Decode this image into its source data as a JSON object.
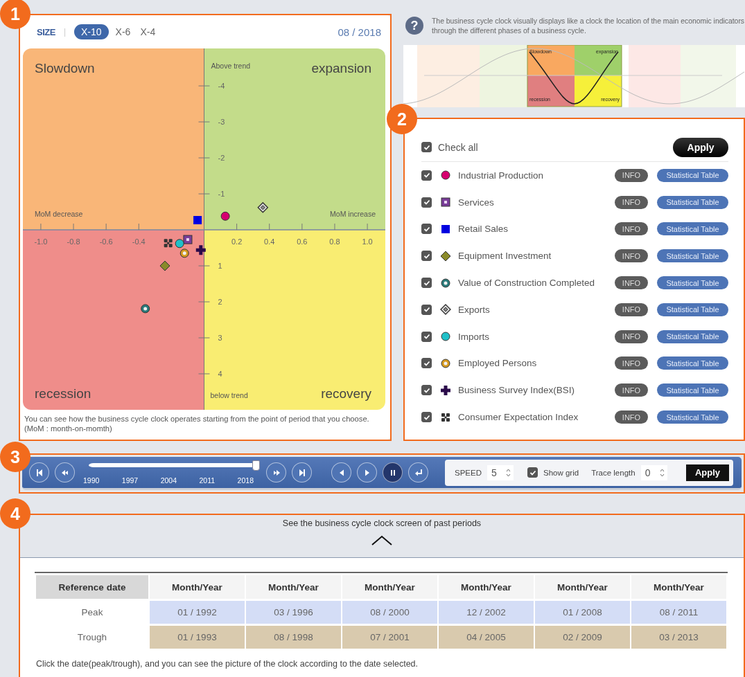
{
  "badges": [
    {
      "label": "1"
    },
    {
      "label": "2"
    },
    {
      "label": "3"
    },
    {
      "label": "4"
    }
  ],
  "clock_panel": {
    "quadrants": [
      {
        "label": "Slowdown",
        "color": "#f9b678"
      },
      {
        "label": "expansion",
        "color": "#c3dc8a"
      },
      {
        "label": "recession",
        "color": "#ef8d8a"
      },
      {
        "label": "recovery",
        "color": "#f9ed72"
      }
    ],
    "axis_labels": [
      {
        "kind": "top",
        "label": "Above trend"
      },
      {
        "kind": "bottom",
        "label": "below trend"
      },
      {
        "kind": "left",
        "label": "MoM decrease"
      },
      {
        "kind": "right",
        "label": "MoM increase"
      }
    ],
    "size_label": "SIZE",
    "separator": "|",
    "size_tabs": [
      {
        "label": "X-10",
        "selected": true
      },
      {
        "label": "X-6",
        "selected": false
      },
      {
        "label": "X-4",
        "selected": false
      }
    ],
    "date": "08 / 2018",
    "chart_data": {
      "type": "scatter",
      "xlim": [
        -1.11,
        1.11
      ],
      "ylim": [
        5.0,
        -5.04
      ],
      "xticks": [
        {
          "value": -1,
          "label": "-1.0"
        },
        {
          "value": -0.8,
          "label": "-0.8"
        },
        {
          "value": -0.6,
          "label": "-0.6"
        },
        {
          "value": -0.4,
          "label": "-0.4"
        },
        {
          "value": 0.2,
          "label": "0.2"
        },
        {
          "value": 0.4,
          "label": "0.4"
        },
        {
          "value": 0.6,
          "label": "0.6"
        },
        {
          "value": 0.8,
          "label": "0.8"
        },
        {
          "value": 1,
          "label": "1.0"
        }
      ],
      "yticks": [
        {
          "value": -4,
          "label": "-4"
        },
        {
          "value": -3,
          "label": "-3"
        },
        {
          "value": -2,
          "label": "-2"
        },
        {
          "value": -1,
          "label": "-1"
        },
        {
          "value": 1,
          "label": "1"
        },
        {
          "value": 2,
          "label": "2"
        },
        {
          "value": 3,
          "label": "3"
        },
        {
          "value": 4,
          "label": "4"
        }
      ],
      "series": [
        {
          "color": "#d6006f",
          "x": [
            0.13
          ],
          "values": [
            -0.38
          ]
        },
        {
          "color": "#7a3d9a",
          "x": [
            -0.1
          ],
          "values": [
            0.27
          ]
        },
        {
          "color": "#0000e0",
          "x": [
            -0.04
          ],
          "values": [
            -0.27
          ]
        },
        {
          "color": "#8a8a2a",
          "x": [
            -0.24
          ],
          "values": [
            1.0
          ]
        },
        {
          "color": "#2a7a7a",
          "x": [
            -0.36
          ],
          "values": [
            2.19
          ]
        },
        {
          "color": "#888888",
          "x": [
            0.36
          ],
          "values": [
            -0.62
          ]
        },
        {
          "color": "#20c0c8",
          "x": [
            -0.15
          ],
          "values": [
            0.38
          ]
        },
        {
          "color": "#d69a20",
          "x": [
            -0.12
          ],
          "values": [
            0.65
          ]
        },
        {
          "color": "#2a0a4a",
          "x": [
            -0.02
          ],
          "values": [
            0.56
          ]
        },
        {
          "color": "#333333",
          "x": [
            -0.22
          ],
          "values": [
            0.37
          ]
        }
      ]
    },
    "caption": "You can see how the business cycle clock operates starting from the point of period that you choose. (MoM : month-on-momth)"
  },
  "help": {
    "icon_glyph": "?",
    "text": "The business cycle clock visually displays like a clock the location of the main economic indicators through the different phases of a business cycle.",
    "diagram_labels": [
      "Slowdown",
      "expansion",
      "recession",
      "recovery"
    ]
  },
  "indicator_panel": {
    "check_all": {
      "label": "Check all",
      "checked": true
    },
    "apply": "Apply",
    "indicators": [
      {
        "name": "Industrial Production",
        "kind": "circle",
        "color": "#d6006f",
        "checked": true,
        "info": "INFO",
        "table": "Statistical Table"
      },
      {
        "name": "Services",
        "kind": "square-dot",
        "color": "#7a3d9a",
        "checked": true,
        "info": "INFO",
        "table": "Statistical Table"
      },
      {
        "name": "Retail Sales",
        "kind": "square",
        "color": "#0000e0",
        "checked": true,
        "info": "INFO",
        "table": "Statistical Table"
      },
      {
        "name": "Equipment Investment",
        "kind": "diamond",
        "color": "#8a8a2a",
        "checked": true,
        "info": "INFO",
        "table": "Statistical Table"
      },
      {
        "name": "Value of Construction Completed",
        "kind": "ring",
        "color": "#2a7a7a",
        "checked": true,
        "info": "INFO",
        "table": "Statistical Table"
      },
      {
        "name": "Exports",
        "kind": "diamond-ring",
        "color": "#888888",
        "checked": true,
        "info": "INFO",
        "table": "Statistical Table"
      },
      {
        "name": "Imports",
        "kind": "circle",
        "color": "#20c0c8",
        "checked": true,
        "info": "INFO",
        "table": "Statistical Table"
      },
      {
        "name": "Employed Persons",
        "kind": "ring",
        "color": "#d69a20",
        "checked": true,
        "info": "INFO",
        "table": "Statistical Table"
      },
      {
        "name": "Business Survey Index(BSI)",
        "kind": "cross",
        "color": "#2a0a4a",
        "checked": true,
        "info": "INFO",
        "table": "Statistical Table"
      },
      {
        "name": "Consumer Expectation Index",
        "kind": "quad",
        "color": "#333333",
        "checked": true,
        "info": "INFO",
        "table": "Statistical Table"
      }
    ]
  },
  "player": {
    "slider": {
      "level": 1.0,
      "years": [
        "1990",
        "1997",
        "2004",
        "2011",
        "2018"
      ]
    },
    "speed": {
      "label": "SPEED",
      "value": "5"
    },
    "show_grid": {
      "label": "Show grid",
      "checked": true
    },
    "trace": {
      "label": "Trace length",
      "value": "0"
    },
    "apply": "Apply"
  },
  "history": {
    "title": "See the business cycle clock screen of past periods",
    "expanded": true,
    "columns": [
      "Reference date",
      "Month/Year",
      "Month/Year",
      "Month/Year",
      "Month/Year",
      "Month/Year",
      "Month/Year"
    ],
    "rows": [
      {
        "kind": "peak",
        "cells": [
          "Peak",
          "01 / 1992",
          "03 / 1996",
          "08 / 2000",
          "12 / 2002",
          "01 / 2008",
          "08 / 2011"
        ]
      },
      {
        "kind": "trough",
        "cells": [
          "Trough",
          "01 / 1993",
          "08 / 1998",
          "07 / 2001",
          "04 / 2005",
          "02 / 2009",
          "03 / 2013"
        ]
      }
    ],
    "note": "Click the date(peak/trough), and you can see the picture of the clock according to the date selected."
  }
}
